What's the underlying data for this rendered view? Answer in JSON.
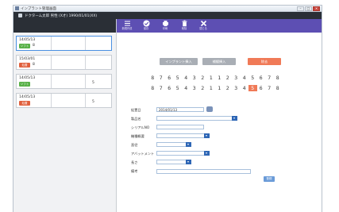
{
  "window": {
    "title": "インプラント管理画面",
    "buttons": {
      "minimize": "–",
      "maximize": "□",
      "close": "✕"
    }
  },
  "patient_bar": {
    "text": "ドクターム太郎 男性 (X才) 1990/01/01(XX)"
  },
  "sidebar": {
    "cards": [
      {
        "date": "14/05/13",
        "badge": "ソフト",
        "badge_color": "green",
        "value": "8",
        "value2": "",
        "selected": true
      },
      {
        "date": "15/03/01",
        "badge": "処置",
        "badge_color": "red",
        "value": "8",
        "value2": "",
        "selected": false
      },
      {
        "date": "14/05/13",
        "badge": "ソフト",
        "badge_color": "green",
        "value": "",
        "value2": "5",
        "selected": false
      },
      {
        "date": "14/05/13",
        "badge": "処置",
        "badge_color": "red",
        "value": "",
        "value2": "5",
        "selected": false
      }
    ]
  },
  "toolbar": {
    "buttons": [
      {
        "icon": "list-icon",
        "label": "新規作成"
      },
      {
        "icon": "check-icon",
        "label": "保存"
      },
      {
        "icon": "print-icon",
        "label": "印刷"
      },
      {
        "icon": "trash-icon",
        "label": "削除"
      },
      {
        "icon": "close-icon",
        "label": "閉じる"
      }
    ]
  },
  "actions": {
    "implant_insert": "インプラント挿入",
    "abutment_insert": "補綴挿入",
    "remove": "除去"
  },
  "tooth_chart": {
    "upper": [
      "8",
      "7",
      "6",
      "5",
      "4",
      "3",
      "2",
      "1",
      "1",
      "2",
      "3",
      "4",
      "5",
      "6",
      "7",
      "8"
    ],
    "lower": [
      "8",
      "7",
      "6",
      "5",
      "4",
      "3",
      "2",
      "1",
      "1",
      "2",
      "3",
      "4",
      "5",
      "6",
      "7",
      "8"
    ],
    "highlighted_lower_index": 12,
    "highlight_color": "#f07a57"
  },
  "form": {
    "date_label": "処置日",
    "date_value": "2014/01/13",
    "product_label": "製品名",
    "product_value": "",
    "serial_label": "シリアルNO",
    "serial_value": "",
    "model_label": "機種概要",
    "model_value": "",
    "diameter_label": "直径",
    "diameter_value": "",
    "abutment_label": "アバットメント",
    "abutment_value": "",
    "length_label": "長さ",
    "length_value": "",
    "notes_label": "備考",
    "notes_value": "",
    "register_button": "登録"
  },
  "colors": {
    "toolbar": "#5d4fb3",
    "dark_bar": "#2a2f36",
    "accent_orange": "#f07a57",
    "badge_green": "#56b046",
    "badge_red": "#e05f3c",
    "dropdown_blue": "#2e66b5"
  }
}
